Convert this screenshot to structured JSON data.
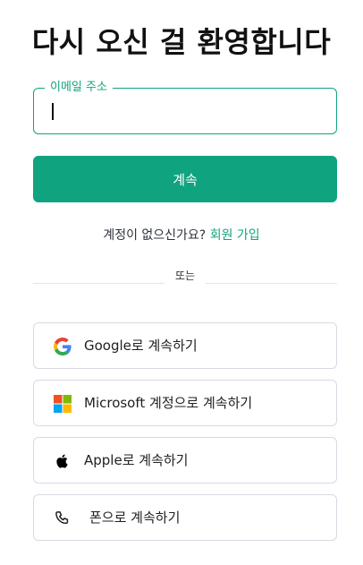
{
  "title": "다시 오신 걸 환영합니다",
  "email": {
    "label": "이메일 주소",
    "value": ""
  },
  "continue_button": "계속",
  "signup": {
    "prompt": "계정이 없으신가요?",
    "link": "회원 가입"
  },
  "divider": "또는",
  "social": {
    "google": {
      "label": "Google로 계속하기",
      "icon": "google-icon"
    },
    "microsoft": {
      "label": "Microsoft 계정으로 계속하기",
      "icon": "microsoft-icon"
    },
    "apple": {
      "label": "Apple로 계속하기",
      "icon": "apple-icon"
    },
    "phone": {
      "label": "폰으로 계속하기",
      "icon": "phone-icon"
    }
  },
  "colors": {
    "accent": "#10a37f",
    "border": "#d9d9e3",
    "text": "#202123"
  }
}
